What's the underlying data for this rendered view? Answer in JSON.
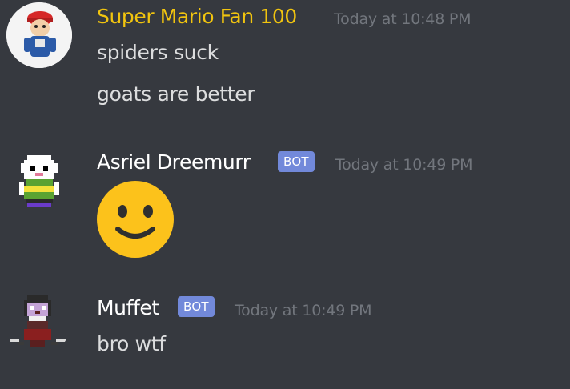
{
  "colors": {
    "background": "#36393f",
    "message_text": "#dcddde",
    "timestamp": "#72767d",
    "bot_badge": "#7289da"
  },
  "messages": [
    {
      "author": "Super Mario Fan 100",
      "author_color": "#f1c40f",
      "timestamp": "Today at 10:48 PM",
      "avatar_icon": "cartoon-character-avatar",
      "lines": [
        "spiders suck",
        "goats are better"
      ]
    },
    {
      "author": "Asriel Dreemurr",
      "author_color": "#ffffff",
      "badge": "BOT",
      "timestamp": "Today at 10:49 PM",
      "avatar_icon": "asriel-sprite-avatar",
      "emoji": "slightly-smiling-face-emoji"
    },
    {
      "author": "Muffet",
      "author_color": "#ffffff",
      "badge": "BOT",
      "timestamp": "Today at 10:49 PM",
      "avatar_icon": "muffet-sprite-avatar",
      "lines": [
        "bro wtf"
      ]
    }
  ]
}
